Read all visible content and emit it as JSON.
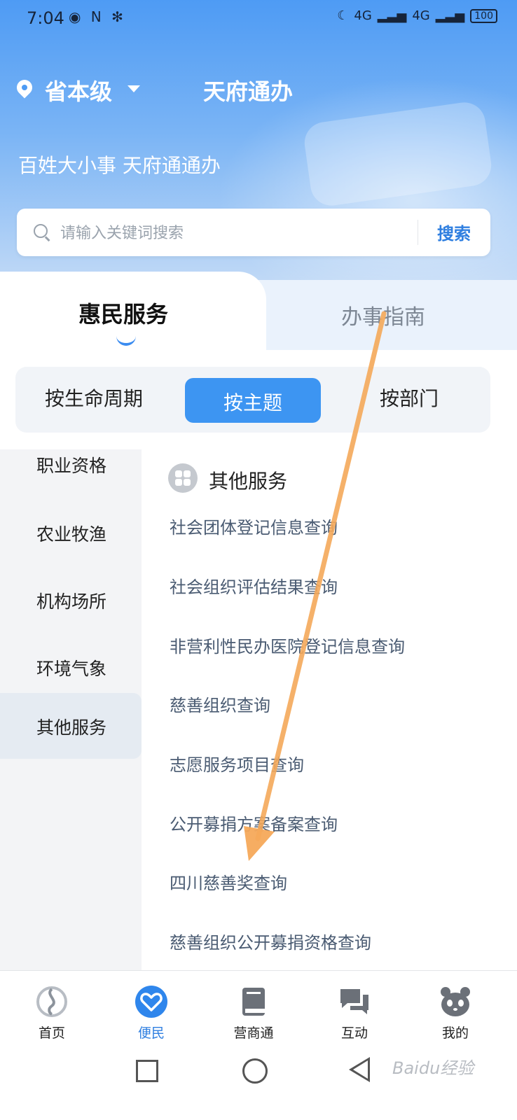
{
  "status_bar": {
    "time": "7:04",
    "left_icons": "◉ N ✻",
    "network1": "4G",
    "network2": "4G",
    "battery": "100"
  },
  "header": {
    "location": "省本级",
    "title": "天府通办",
    "slogan": "百姓大小事 天府通通办"
  },
  "search": {
    "placeholder": "请输入关键词搜索",
    "button_label": "搜索"
  },
  "tabs": {
    "active": "惠民服务",
    "inactive": "办事指南"
  },
  "segments": [
    "按生命周期",
    "按主题",
    "按部门"
  ],
  "sidebar": {
    "items": [
      "职业资格",
      "农业牧渔",
      "机构场所",
      "环境气象",
      "其他服务"
    ],
    "active_index": 4
  },
  "section": {
    "title": "其他服务",
    "items": [
      "社会团体登记信息查询",
      "社会组织评估结果查询",
      "非营利性民办医院登记信息查询",
      "慈善组织查询",
      "志愿服务项目查询",
      "公开募捐方案备案查询",
      "四川慈善奖查询",
      "慈善组织公开募捐资格查询"
    ]
  },
  "bottom_nav": [
    {
      "label": "首页",
      "icon": "home-logo-icon"
    },
    {
      "label": "便民",
      "icon": "heart-hands-icon"
    },
    {
      "label": "营商通",
      "icon": "book-icon"
    },
    {
      "label": "互动",
      "icon": "chat-bubbles-icon"
    },
    {
      "label": "我的",
      "icon": "panda-icon"
    }
  ],
  "watermark": "Baidu经验",
  "colors": {
    "accent": "#3d95f2",
    "annotation_arrow": "#f5a95a"
  }
}
